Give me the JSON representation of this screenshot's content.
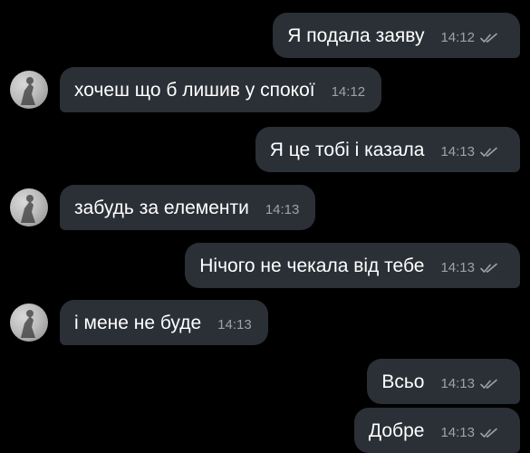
{
  "messages": [
    {
      "text": "Я подала заяву",
      "time": "14:12",
      "direction": "out"
    },
    {
      "text": "хочеш що б лишив у спокої",
      "time": "14:12",
      "direction": "in"
    },
    {
      "text": "Я це тобі і казала",
      "time": "14:13",
      "direction": "out"
    },
    {
      "text": "забудь за елементи",
      "time": "14:13",
      "direction": "in"
    },
    {
      "text": "Нічого не чекала від тебе",
      "time": "14:13",
      "direction": "out"
    },
    {
      "text": "і мене не буде",
      "time": "14:13",
      "direction": "in"
    },
    {
      "text": "Всьо",
      "time": "14:13",
      "direction": "out"
    },
    {
      "text": "Добре",
      "time": "14:13",
      "direction": "out"
    }
  ],
  "colors": {
    "background": "#000000",
    "bubble": "#2b3037",
    "text": "#ffffff",
    "meta": "#9aa3ad"
  },
  "icons": {
    "read_status": "double-check-icon",
    "avatar": "contact-avatar"
  }
}
